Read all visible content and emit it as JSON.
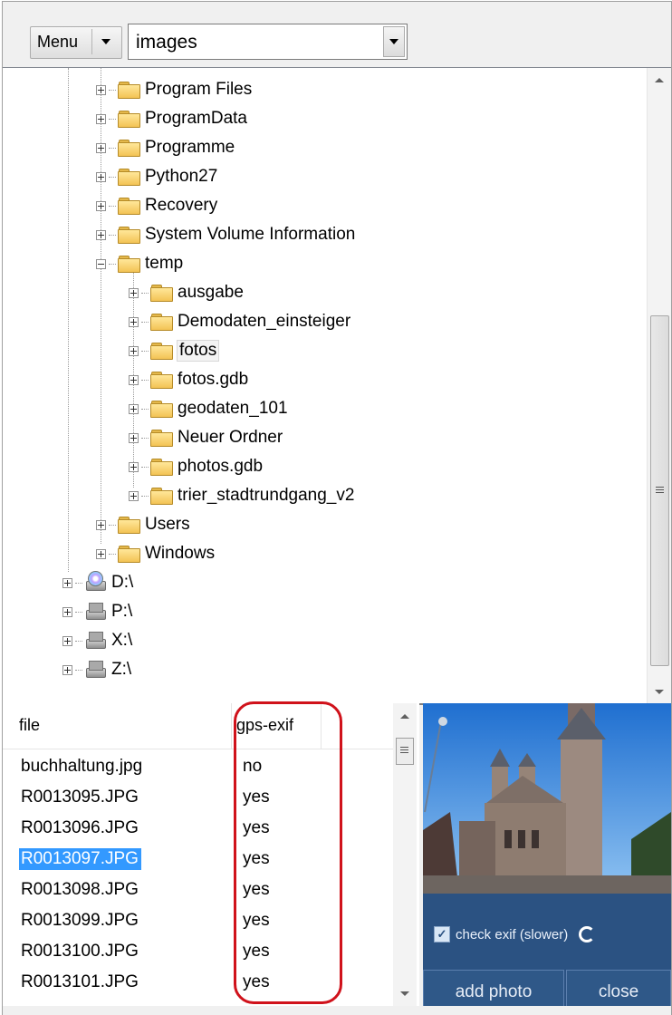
{
  "toolbar": {
    "menu_label": "Menu",
    "path_value": "images"
  },
  "tree": {
    "folders": [
      {
        "label": "Program Files"
      },
      {
        "label": "ProgramData"
      },
      {
        "label": "Programme"
      },
      {
        "label": "Python27"
      },
      {
        "label": "Recovery"
      },
      {
        "label": "System Volume Information"
      },
      {
        "label": "temp"
      },
      {
        "label": "ausgabe"
      },
      {
        "label": "Demodaten_einsteiger"
      },
      {
        "label": "fotos"
      },
      {
        "label": "fotos.gdb"
      },
      {
        "label": "geodaten_101"
      },
      {
        "label": "Neuer Ordner"
      },
      {
        "label": "photos.gdb"
      },
      {
        "label": "trier_stadtrundgang_v2"
      },
      {
        "label": "Users"
      },
      {
        "label": "Windows"
      }
    ],
    "drives": [
      {
        "label": "D:\\"
      },
      {
        "label": "P:\\"
      },
      {
        "label": "X:\\"
      },
      {
        "label": "Z:\\"
      }
    ],
    "selected": "fotos"
  },
  "filelist": {
    "columns": [
      "file",
      "gps-exif"
    ],
    "rows": [
      {
        "file": "buchhaltung.jpg",
        "gps": "no"
      },
      {
        "file": "R0013095.JPG",
        "gps": "yes"
      },
      {
        "file": "R0013096.JPG",
        "gps": "yes"
      },
      {
        "file": "R0013097.JPG",
        "gps": "yes"
      },
      {
        "file": "R0013098.JPG",
        "gps": "yes"
      },
      {
        "file": "R0013099.JPG",
        "gps": "yes"
      },
      {
        "file": "R0013100.JPG",
        "gps": "yes"
      },
      {
        "file": "R0013101.JPG",
        "gps": "yes"
      }
    ],
    "selected_file": "R0013097.JPG"
  },
  "controls": {
    "check_exif_label": "check exif (slower)",
    "check_exif_checked": true,
    "add_photo_label": "add photo",
    "close_label": "close"
  },
  "colors": {
    "selection": "#3399ff",
    "highlight": "#d0121b",
    "panel": "#2b5282"
  },
  "icons": {
    "folder": "folder-icon",
    "drive": "network-drive-icon",
    "cd": "cd-drive-icon"
  }
}
